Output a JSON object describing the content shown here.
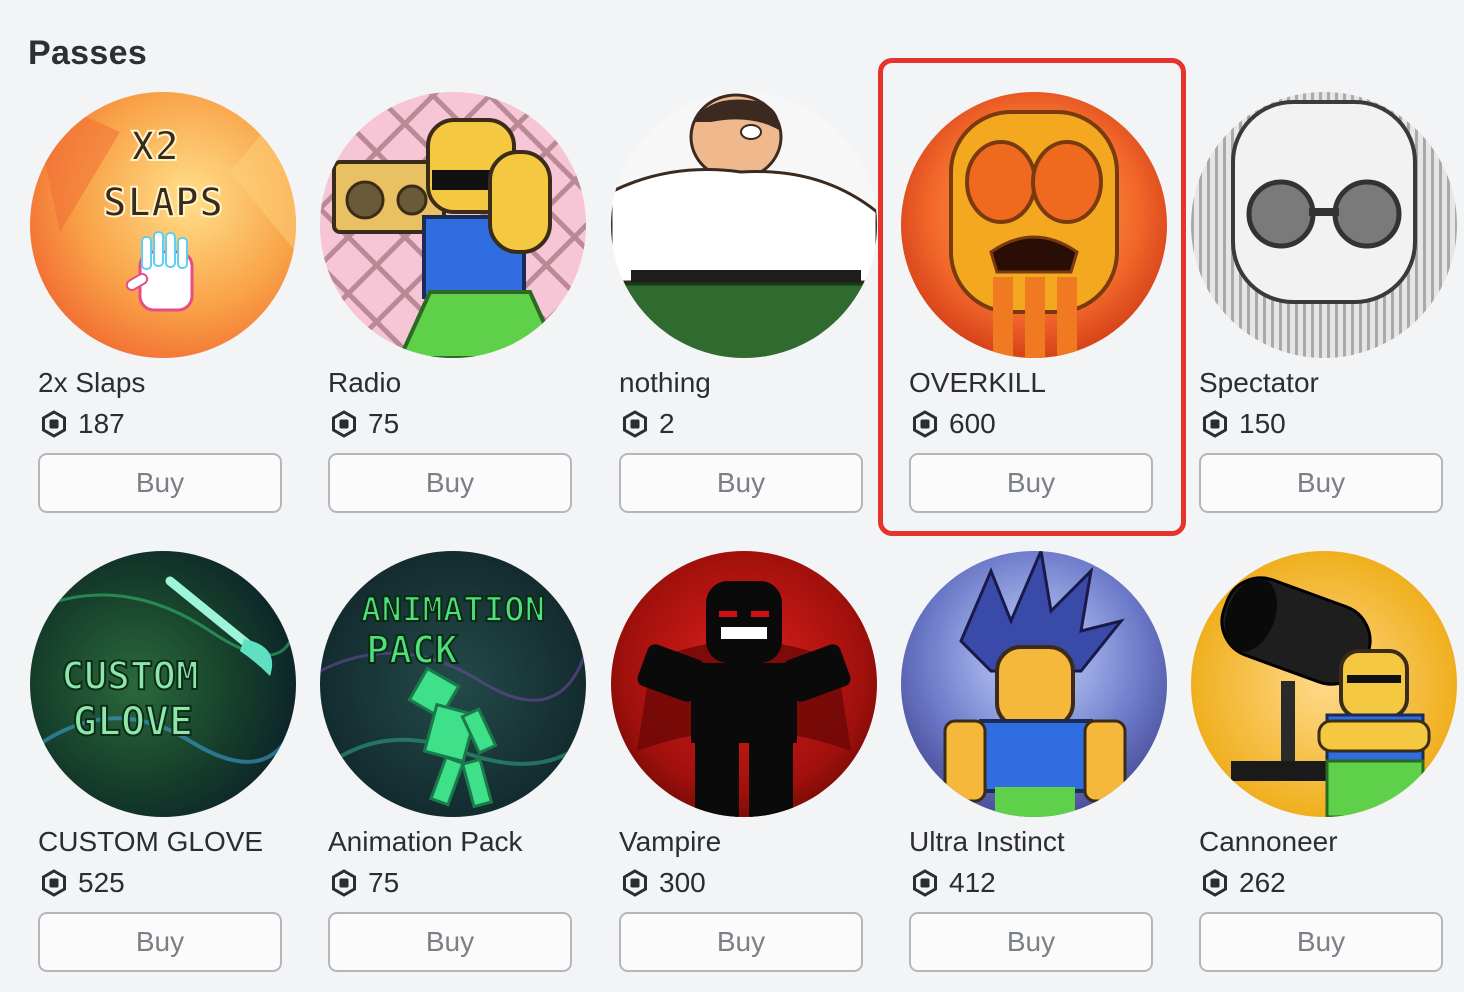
{
  "section": {
    "title": "Passes"
  },
  "passes": [
    {
      "name": "2x Slaps",
      "price": "187",
      "buy_label": "Buy"
    },
    {
      "name": "Radio",
      "price": "75",
      "buy_label": "Buy"
    },
    {
      "name": "nothing",
      "price": "2",
      "buy_label": "Buy"
    },
    {
      "name": "OVERKILL",
      "price": "600",
      "buy_label": "Buy"
    },
    {
      "name": "Spectator",
      "price": "150",
      "buy_label": "Buy"
    },
    {
      "name": "CUSTOM GLOVE",
      "price": "525",
      "buy_label": "Buy"
    },
    {
      "name": "Animation Pack",
      "price": "75",
      "buy_label": "Buy"
    },
    {
      "name": "Vampire",
      "price": "300",
      "buy_label": "Buy"
    },
    {
      "name": "Ultra Instinct",
      "price": "412",
      "buy_label": "Buy"
    },
    {
      "name": "Cannoneer",
      "price": "262",
      "buy_label": "Buy"
    }
  ],
  "thumb_text": {
    "slaps_line1": "X2",
    "slaps_line2": "SLAPS",
    "glove_line1": "CUSTOM",
    "glove_line2": "GLOVE",
    "anim_line1": "ANIMATION",
    "anim_line2": "PACK"
  },
  "icons": {
    "currency": "robux-icon"
  },
  "highlighted_pass": "OVERKILL",
  "colors": {
    "highlight": "#e5342b",
    "background": "#f3f4f6",
    "button_border": "#b3b7bc"
  }
}
